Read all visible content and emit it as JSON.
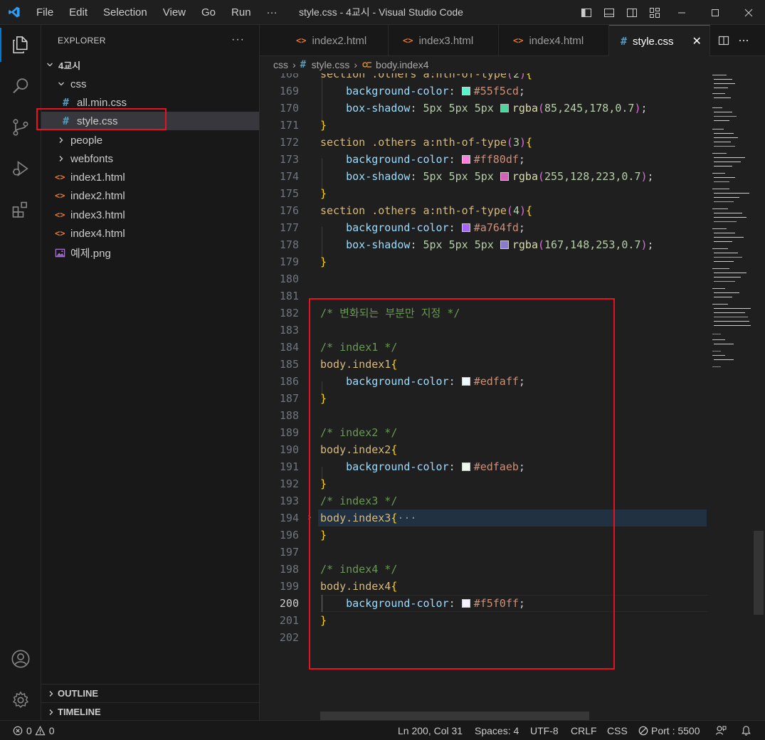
{
  "window": {
    "title": "style.css - 4교시 - Visual Studio Code",
    "menu": [
      "File",
      "Edit",
      "Selection",
      "View",
      "Go",
      "Run",
      "···"
    ]
  },
  "sidebar": {
    "header": "EXPLORER",
    "more": "···",
    "root": "4교시",
    "tree": [
      {
        "label": "css",
        "kind": "folder-open"
      },
      {
        "label": "all.min.css",
        "kind": "css"
      },
      {
        "label": "style.css",
        "kind": "css",
        "selected": true
      },
      {
        "label": "people",
        "kind": "folder"
      },
      {
        "label": "webfonts",
        "kind": "folder"
      },
      {
        "label": "index1.html",
        "kind": "html"
      },
      {
        "label": "index2.html",
        "kind": "html"
      },
      {
        "label": "index3.html",
        "kind": "html"
      },
      {
        "label": "index4.html",
        "kind": "html"
      },
      {
        "label": "예제.png",
        "kind": "image"
      }
    ],
    "outline": "OUTLINE",
    "timeline": "TIMELINE"
  },
  "tabs": [
    {
      "label": "index2.html",
      "icon": "<>"
    },
    {
      "label": "index3.html",
      "icon": "<>"
    },
    {
      "label": "index4.html",
      "icon": "<>"
    },
    {
      "label": "style.css",
      "icon": "#",
      "active": true,
      "close": "✕"
    }
  ],
  "breadcrumb": {
    "items": [
      "css",
      "style.css",
      "body.index4"
    ]
  },
  "editor": {
    "current_line": "200",
    "accent_color": "#0078d4",
    "highlight_box_color": "#e81123",
    "lines": [
      {
        "n": "168",
        "text": "section .others a:nth-of-type(2){"
      },
      {
        "n": "169",
        "text": "background-color: #55f5cd;",
        "swatch": "#55f5cd"
      },
      {
        "n": "170",
        "text": "box-shadow: 5px 5px 5px rgba(85,245,178,0.7);",
        "swatch": "#55f5b2"
      },
      {
        "n": "171",
        "text": "}"
      },
      {
        "n": "172",
        "text": "section .others a:nth-of-type(3){"
      },
      {
        "n": "173",
        "text": "background-color: #ff80df;",
        "swatch": "#ff80df"
      },
      {
        "n": "174",
        "text": "box-shadow: 5px 5px 5px rgba(255,128,223,0.7);",
        "swatch": "#ff80df"
      },
      {
        "n": "175",
        "text": "}"
      },
      {
        "n": "176",
        "text": "section .others a:nth-of-type(4){"
      },
      {
        "n": "177",
        "text": "background-color: #a764fd;",
        "swatch": "#a764fd"
      },
      {
        "n": "178",
        "text": "box-shadow: 5px 5px 5px rgba(167,148,253,0.7);",
        "swatch": "#a794fd"
      },
      {
        "n": "179",
        "text": "}"
      },
      {
        "n": "180",
        "text": ""
      },
      {
        "n": "181",
        "text": ""
      },
      {
        "n": "182",
        "text": "/* 변화되는 부분만 지정 */"
      },
      {
        "n": "183",
        "text": ""
      },
      {
        "n": "184",
        "text": "/* index1 */"
      },
      {
        "n": "185",
        "text": "body.index1{"
      },
      {
        "n": "186",
        "text": "background-color: #edfaff;",
        "swatch": "#edfaff"
      },
      {
        "n": "187",
        "text": "}"
      },
      {
        "n": "188",
        "text": ""
      },
      {
        "n": "189",
        "text": "/* index2 */"
      },
      {
        "n": "190",
        "text": "body.index2{"
      },
      {
        "n": "191",
        "text": "background-color: #edfaeb;",
        "swatch": "#edfaeb"
      },
      {
        "n": "192",
        "text": "}"
      },
      {
        "n": "193",
        "text": "/* index3 */"
      },
      {
        "n": "194",
        "text": "body.index3{···"
      },
      {
        "n": "196",
        "text": "}"
      },
      {
        "n": "197",
        "text": ""
      },
      {
        "n": "198",
        "text": "/* index4 */"
      },
      {
        "n": "199",
        "text": "body.index4{"
      },
      {
        "n": "200",
        "text": "background-color: #f5f0ff;",
        "swatch": "#f5f0ff"
      },
      {
        "n": "201",
        "text": "}"
      },
      {
        "n": "202",
        "text": ""
      }
    ]
  },
  "statusbar": {
    "errors": "0",
    "warnings": "0",
    "position": "Ln 200, Col 31",
    "spaces": "Spaces: 4",
    "encoding": "UTF-8",
    "eol": "CRLF",
    "language": "CSS",
    "port": "Port : 5500"
  }
}
